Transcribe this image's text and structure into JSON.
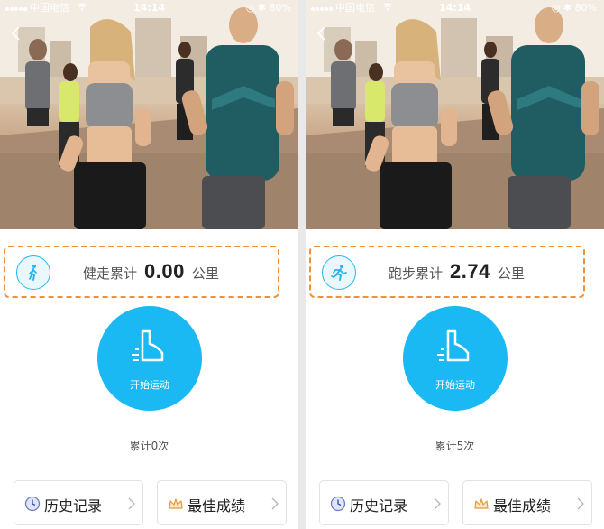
{
  "colors": {
    "accent": "#1ab9f3",
    "highlight_border": "#f0913a",
    "text_primary": "#222222",
    "text_secondary": "#555555"
  },
  "panels": [
    {
      "status": {
        "carrier": "中国电信",
        "time": "14:14",
        "battery": "80%"
      },
      "stat": {
        "icon": "walking-person-icon",
        "label": "健走累计",
        "value": "0.00",
        "unit": "公里"
      },
      "start_button": {
        "icon": "shoe-icon",
        "label": "开始运动"
      },
      "count_text": "累计0次",
      "history": {
        "icon": "clock-icon",
        "label": "历史记录"
      },
      "best": {
        "icon": "crown-icon",
        "label": "最佳成绩"
      }
    },
    {
      "status": {
        "carrier": "中国电信",
        "time": "14:14",
        "battery": "80%"
      },
      "stat": {
        "icon": "running-person-icon",
        "label": "跑步累计",
        "value": "2.74",
        "unit": "公里"
      },
      "start_button": {
        "icon": "shoe-icon",
        "label": "开始运动"
      },
      "count_text": "累计5次",
      "history": {
        "icon": "clock-icon",
        "label": "历史记录"
      },
      "best": {
        "icon": "crown-icon",
        "label": "最佳成绩"
      }
    }
  ]
}
